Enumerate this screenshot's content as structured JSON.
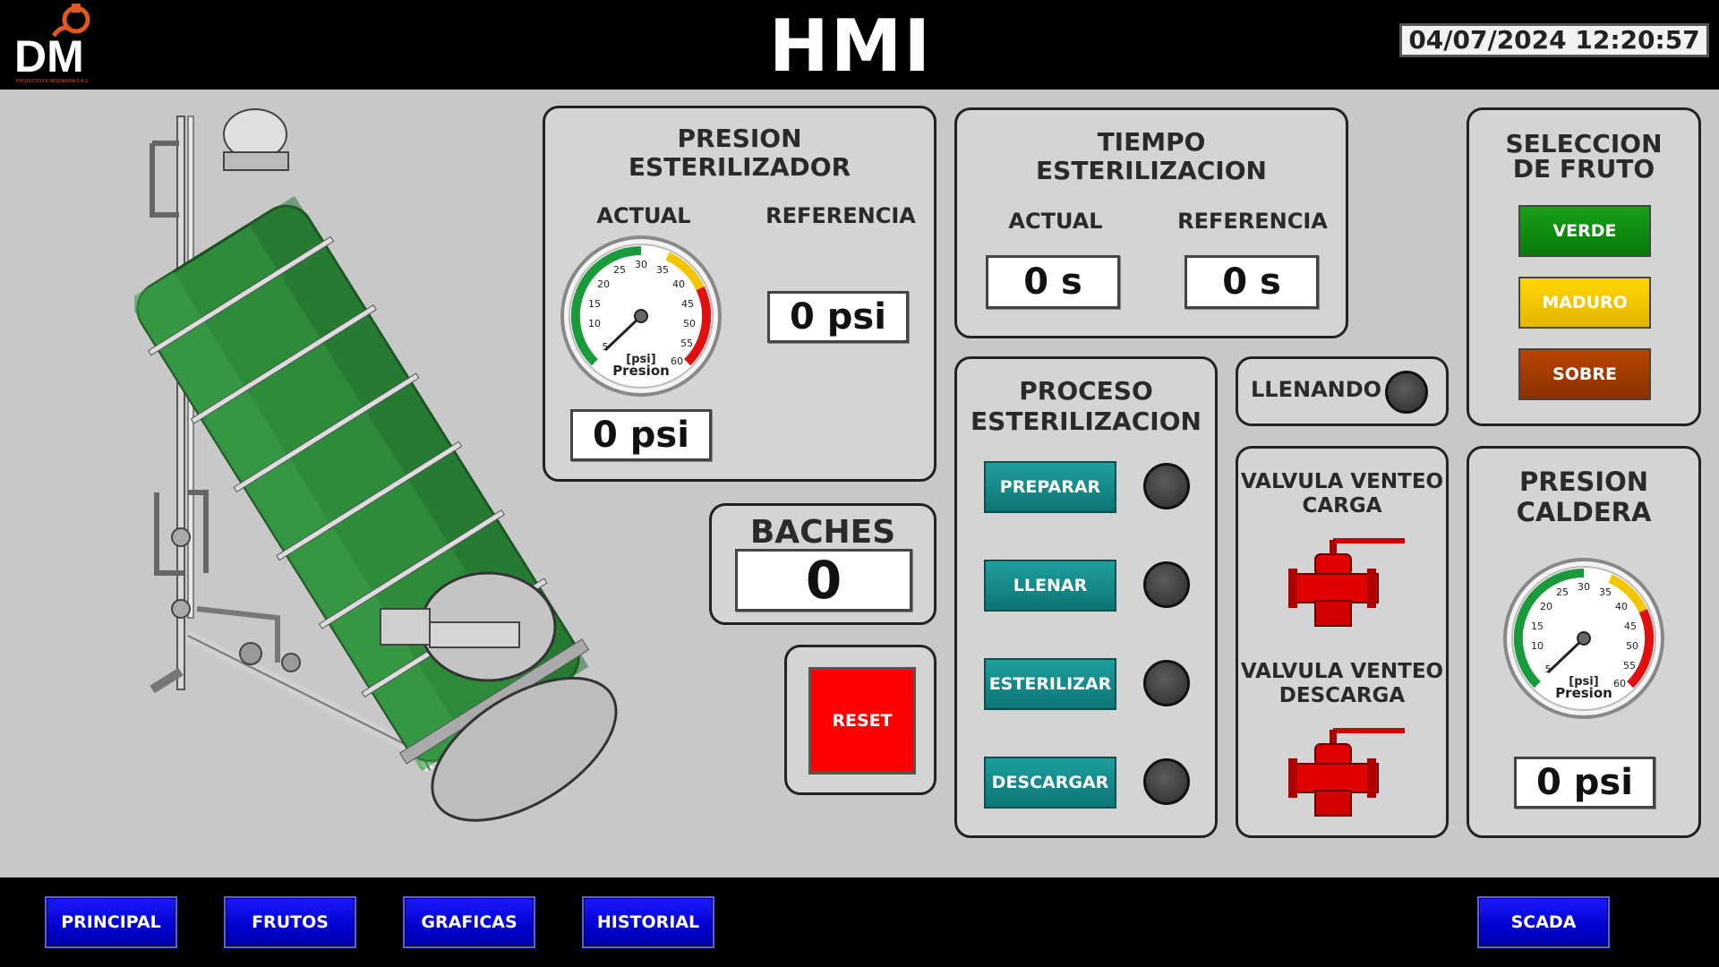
{
  "header": {
    "title": "HMI",
    "datetime": "04/07/2024 12:20:57",
    "logo_text": "DM",
    "logo_subtext": "PROYECTOS E INGENIERIA S.A.S"
  },
  "presion_esterilizador": {
    "title_line1": "PRESION",
    "title_line2": "ESTERILIZADOR",
    "actual_label": "ACTUAL",
    "referencia_label": "REFERENCIA",
    "actual_value": "0 psi",
    "referencia_value": "0 psi",
    "gauge": {
      "unit": "[psi]",
      "label": "Presion",
      "value": 0,
      "ticks": [
        "5",
        "10",
        "15",
        "20",
        "25",
        "30",
        "35",
        "40",
        "45",
        "50",
        "55",
        "60"
      ]
    }
  },
  "tiempo_esterilizacion": {
    "title_line1": "TIEMPO",
    "title_line2": "ESTERILIZACION",
    "actual_label": "ACTUAL",
    "referencia_label": "REFERENCIA",
    "actual_value": "0 s",
    "referencia_value": "0 s"
  },
  "seleccion_fruto": {
    "title_line1": "SELECCION",
    "title_line2": "DE FRUTO",
    "buttons": [
      "VERDE",
      "MADURO",
      "SOBRE"
    ],
    "colors": [
      "#0a8a0a",
      "#f5c800",
      "#a83a00"
    ]
  },
  "baches": {
    "title": "BACHES",
    "value": "0"
  },
  "reset": {
    "label": "RESET",
    "color": "#ff0000"
  },
  "proceso": {
    "title_line1": "PROCESO",
    "title_line2": "ESTERILIZACION",
    "steps": [
      "PREPARAR",
      "LLENAR",
      "ESTERILIZAR",
      "DESCARGAR"
    ]
  },
  "llenando": {
    "label": "LLENANDO"
  },
  "valvulas": {
    "carga_line1": "VALVULA VENTEO",
    "carga_line2": "CARGA",
    "descarga_line1": "VALVULA VENTEO",
    "descarga_line2": "DESCARGA"
  },
  "presion_caldera": {
    "title_line1": "PRESION",
    "title_line2": "CALDERA",
    "value": "0 psi",
    "gauge": {
      "unit": "[psi]",
      "label": "Presion",
      "value": 0,
      "ticks": [
        "5",
        "10",
        "15",
        "20",
        "25",
        "30",
        "35",
        "40",
        "45",
        "50",
        "55",
        "60"
      ]
    }
  },
  "footer": {
    "nav": [
      "PRINCIPAL",
      "FRUTOS",
      "GRAFICAS",
      "HISTORIAL"
    ],
    "scada": "SCADA"
  }
}
